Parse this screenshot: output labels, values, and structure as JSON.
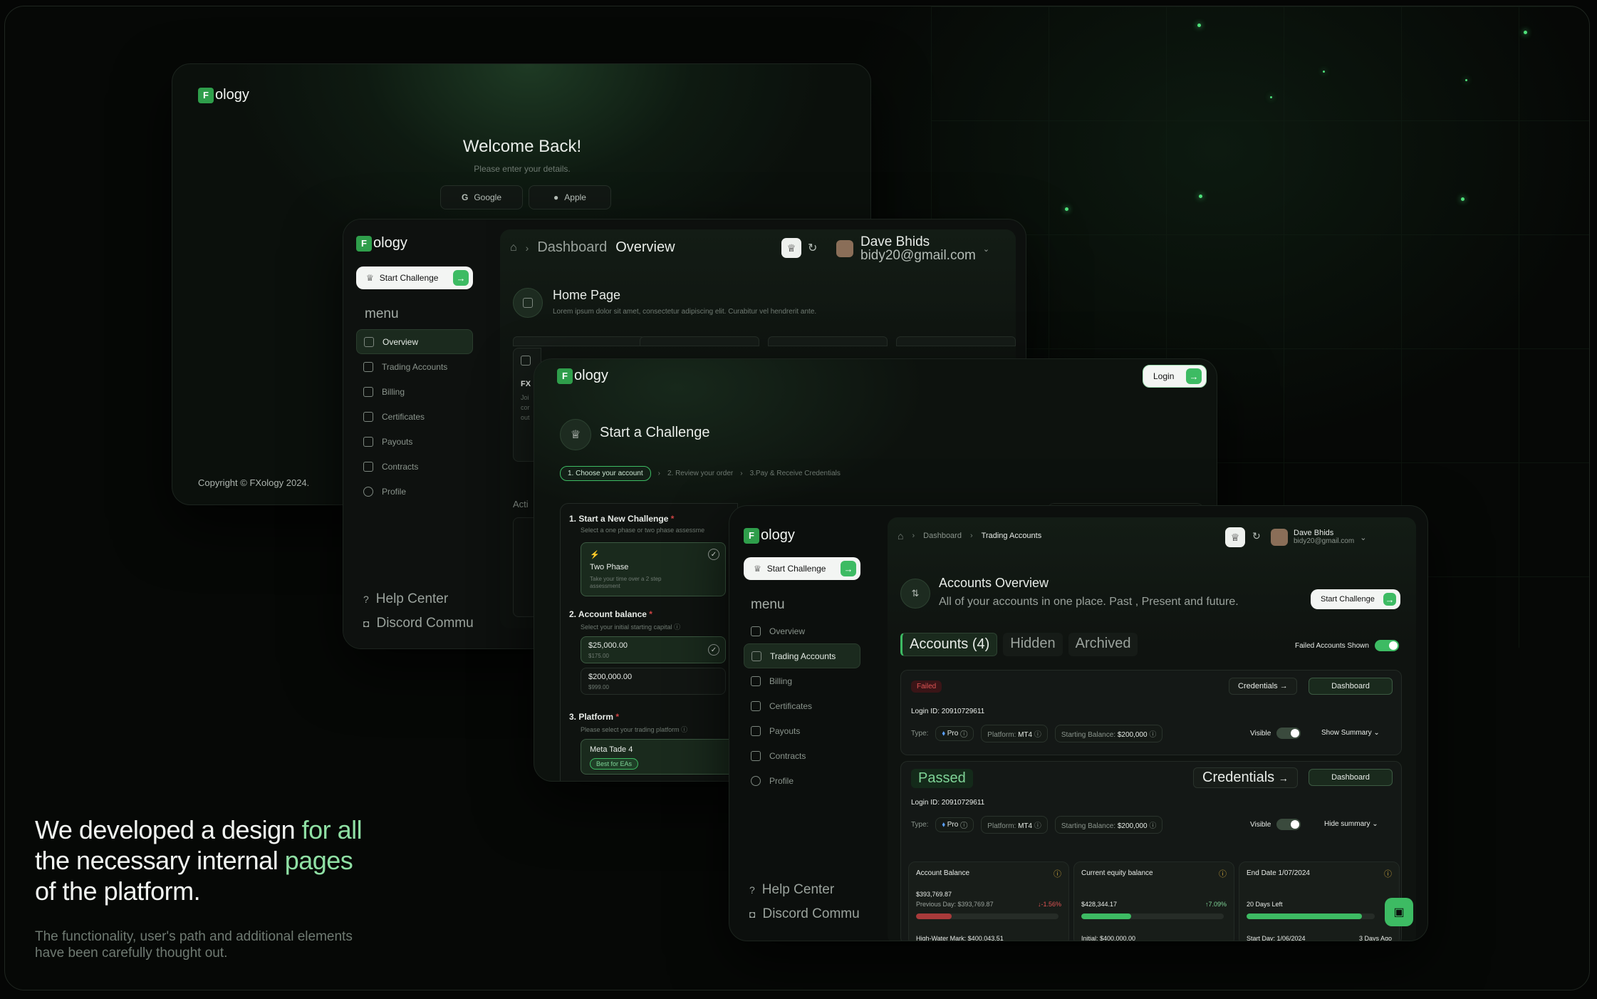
{
  "login": {
    "logo": "ology",
    "title": "Welcome Back!",
    "subtitle": "Please enter your details.",
    "google": "Google",
    "apple": "Apple",
    "copyright": "Copyright © FXology 2024."
  },
  "dash1": {
    "logo": "ology",
    "start_challenge": "Start Challenge",
    "menu_title": "menu",
    "menu": [
      "Overview",
      "Trading Accounts",
      "Billing",
      "Certificates",
      "Payouts",
      "Contracts",
      "Profile"
    ],
    "help": "Help Center",
    "discord": "Discord Commu",
    "breadcrumb_a": "Dashboard",
    "breadcrumb_b": "Overview",
    "user_name": "Dave Bhids",
    "user_email": "bidy20@gmail.com",
    "home_title": "Home Page",
    "home_sub": "Lorem ipsum dolor sit amet, consectetur adipiscing elit. Curabitur vel hendrerit ante.",
    "peek_fx": "FX",
    "peek_acti": "Acti",
    "peek_lines": [
      "Joi",
      "cor",
      "out"
    ]
  },
  "challenge": {
    "logo": "ology",
    "login": "Login",
    "title": "Start a Challenge",
    "steps": [
      "1. Choose your account",
      "2. Review your order",
      "3.Pay & Receive Credentials"
    ],
    "s1_title": "1.  Start a New Challenge",
    "s1_sub": "Select a one phase or two phase assessme",
    "two_phase": "Two Phase",
    "two_phase_sub": "Take your time over a 2 step assessment",
    "s2_title": "2.  Account balance",
    "s2_sub": "Select your initial starting capital",
    "bal1": "$25,000.00",
    "bal1_sub": "$175.00",
    "bal2": "$200,000.00",
    "bal2_sub": "$999.00",
    "s3_title": "3.  Platform",
    "s3_sub": "Please select your trading platform",
    "platform": "Meta Tade 4",
    "badge": "Best for EAs"
  },
  "dash2": {
    "logo": "ology",
    "start_challenge": "Start Challenge",
    "menu_title": "menu",
    "menu": [
      "Overview",
      "Trading Accounts",
      "Billing",
      "Certificates",
      "Payouts",
      "Contracts",
      "Profile"
    ],
    "help": "Help Center",
    "discord": "Discord Commu",
    "breadcrumb_a": "Dashboard",
    "breadcrumb_b": "Trading Accounts",
    "user_name": "Dave Bhids",
    "user_email": "bidy20@gmail.com",
    "ov_title": "Accounts Overview",
    "ov_sub": "All of your accounts in one place. Past , Present and future.",
    "ov_btn": "Start Challenge",
    "tabs": [
      "Accounts (4)",
      "Hidden",
      "Archived"
    ],
    "failed_shown": "Failed Accounts Shown",
    "acc1": {
      "status": "Failed",
      "credentials": "Credentials",
      "dashboard": "Dashboard",
      "login_id": "Login ID:  20910729611",
      "type_label": "Type:",
      "type_val": "Pro",
      "platform_label": "Platform:",
      "platform_val": "MT4",
      "balance_label": "Starting Balance:",
      "balance_val": "$200,000",
      "visible": "Visible",
      "summary": "Show Summary"
    },
    "acc2": {
      "status": "Passed",
      "credentials": "Credentials",
      "dashboard": "Dashboard",
      "login_id": "Login ID:  20910729611",
      "type_label": "Type:",
      "type_val": "Pro",
      "platform_label": "Platform:",
      "platform_val": "MT4",
      "balance_label": "Starting Balance:",
      "balance_val": "$200,000",
      "visible": "Visible",
      "summary": "Hide summary"
    },
    "stats": [
      {
        "label": "Account Balance",
        "value": "$393,769.87",
        "sub": "Previous Day: $393,769.87",
        "delta": "-1.56%",
        "foot": "High-Water Mark: $400,043.51",
        "fill": 0.25
      },
      {
        "label": "Current equity balance",
        "value": "$428,344.17",
        "sub": "",
        "delta": "7.09%",
        "foot": "Initial: $400,000.00",
        "fill": 0.35
      },
      {
        "label": "End Date  1/07/2024",
        "value": "",
        "sub": "20 Days Left",
        "delta": "",
        "foot": "Start Day:  1/06/2024",
        "foot2": "3 Days Ago",
        "fill": 0.9
      }
    ]
  },
  "hero": {
    "line1a": "We developed a design ",
    "line1b": "for all",
    "line2a": "the necessary internal ",
    "line2b": "pages",
    "line3": "of the platform.",
    "sub1": "The functionality, user's path and additional elements",
    "sub2": "have been carefully thought out."
  },
  "colors": {
    "accent": "#3dbb63",
    "bg": "#060806",
    "failed": "#c0393b"
  }
}
